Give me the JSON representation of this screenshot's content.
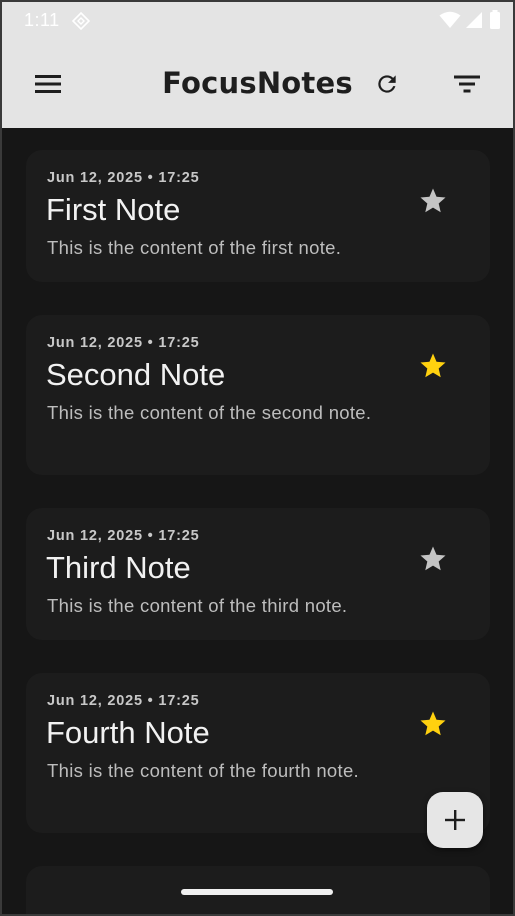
{
  "status_bar": {
    "time": "1:11"
  },
  "app_bar": {
    "title": "FocusNotes"
  },
  "notes": [
    {
      "date": "Jun 12, 2025 • 17:25",
      "title": "First Note",
      "content": "This is the content of the first note.",
      "starred": false
    },
    {
      "date": "Jun 12, 2025 • 17:25",
      "title": "Second Note",
      "content": "This is the content of the second note.",
      "starred": true
    },
    {
      "date": "Jun 12, 2025 • 17:25",
      "title": "Third Note",
      "content": "This is the content of the third note.",
      "starred": false
    },
    {
      "date": "Jun 12, 2025 • 17:25",
      "title": "Fourth Note",
      "content": "This is the content of the fourth note.",
      "starred": true
    }
  ],
  "colors": {
    "star_active": "#ffd10f",
    "star_inactive": "#c4c4c4",
    "app_bar_bg": "#e4e4e4",
    "background": "#161616"
  },
  "icons": {
    "menu": "menu-icon",
    "refresh": "refresh-icon",
    "filter": "filter-icon",
    "add": "add-icon",
    "star": "star-icon"
  }
}
